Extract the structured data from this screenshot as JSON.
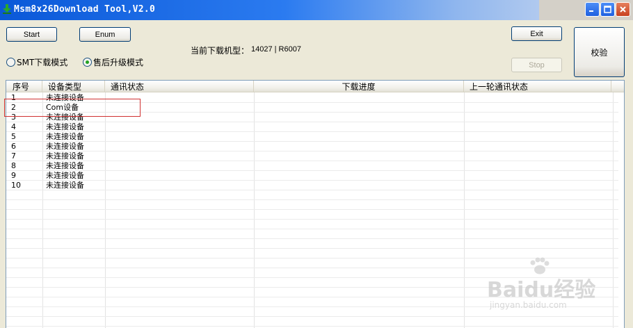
{
  "window": {
    "title": "Msm8x26Download Tool,V2.0"
  },
  "toolbar": {
    "start_label": "Start",
    "enum_label": "Enum",
    "exit_label": "Exit",
    "stop_label": "Stop",
    "verify_label": "校验"
  },
  "mode": {
    "smt_label": "SMT下载模式",
    "aftersales_label": "售后升级模式",
    "selected": "售后升级模式"
  },
  "model": {
    "label": "当前下载机型：",
    "value": "14027 | R6007"
  },
  "table": {
    "columns": [
      "序号",
      "设备类型",
      "通讯状态",
      "下载进度",
      "上一轮通讯状态"
    ],
    "rows": [
      {
        "index": "1",
        "type": "未连接设备"
      },
      {
        "index": "2",
        "type": "Com设备"
      },
      {
        "index": "3",
        "type": "未连接设备"
      },
      {
        "index": "4",
        "type": "未连接设备"
      },
      {
        "index": "5",
        "type": "未连接设备"
      },
      {
        "index": "6",
        "type": "未连接设备"
      },
      {
        "index": "7",
        "type": "未连接设备"
      },
      {
        "index": "8",
        "type": "未连接设备"
      },
      {
        "index": "9",
        "type": "未连接设备"
      },
      {
        "index": "10",
        "type": "未连接设备"
      }
    ]
  },
  "watermark": {
    "brand": "Baidu经验",
    "url": "jingyan.baidu.com"
  },
  "icons": {
    "app": "download-arrow-icon",
    "minimize": "minimize-icon",
    "maximize": "maximize-icon",
    "close": "close-icon"
  },
  "colors": {
    "titlebar_start": "#0a58d8",
    "highlight_box": "#d03030",
    "radio_dot": "#21a121"
  }
}
